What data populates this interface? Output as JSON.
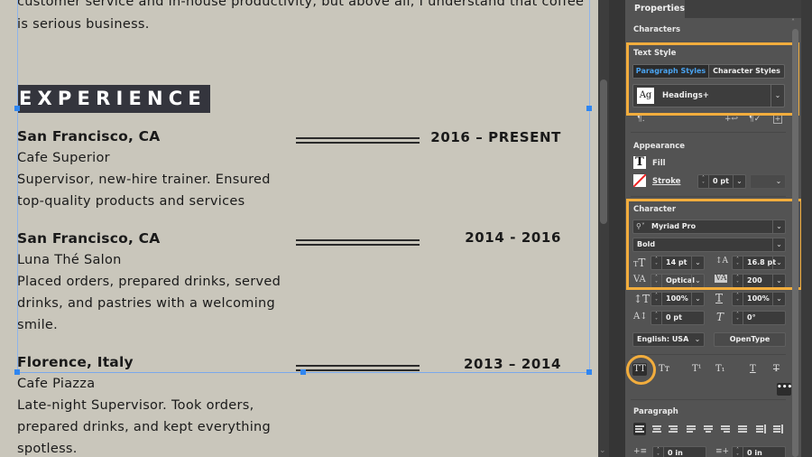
{
  "document": {
    "intro_lines": [
      "customer service and in-house productivity, but above all, I understand that coffee",
      "is serious business."
    ],
    "section_heading": "EXPERIENCE",
    "jobs": [
      {
        "location": "San Francisco, CA",
        "dates": "2016 – PRESENT",
        "employer": "Cafe Superior",
        "description_lines": [
          "Supervisor, new-hire trainer. Ensured",
          "top-quality products and services"
        ]
      },
      {
        "location": "San Francisco, CA",
        "dates": "2014 - 2016",
        "employer": "Luna Thé Salon",
        "description_lines": [
          "Placed orders, prepared drinks, served",
          "drinks, and pastries with a welcoming",
          "smile."
        ]
      },
      {
        "location": "Florence, Italy",
        "dates": "2013 – 2014",
        "employer": "Cafe Piazza",
        "description_lines": [
          "Late-night Supervisor. Took orders,",
          "prepared drinks, and kept everything",
          "spotless."
        ]
      }
    ]
  },
  "panel": {
    "tab": "Properties",
    "context": "Characters",
    "text_style": {
      "title": "Text Style",
      "tabs": [
        {
          "label": "Paragraph Styles",
          "active": true
        },
        {
          "label": "Character Styles",
          "active": false
        }
      ],
      "style_preview": "Ag",
      "selected_style": "Headings+",
      "actions": [
        "clear-overrides-icon",
        "new-style-from-selection-icon",
        "redefine-style-icon",
        "new-style-icon"
      ]
    },
    "appearance": {
      "title": "Appearance",
      "fill_label": "Fill",
      "stroke_label": "Stroke",
      "stroke_weight": "0 pt"
    },
    "character": {
      "title": "Character",
      "font_family": "Myriad Pro",
      "font_style": "Bold",
      "font_size": "14 pt",
      "leading": "16.8 pt",
      "kerning": "Optical",
      "tracking": "200",
      "vertical_scale": "100%",
      "horizontal_scale": "100%",
      "baseline_shift": "0 pt",
      "skew": "0°",
      "language": "English: USA",
      "opentype_label": "OpenType",
      "case_buttons": [
        {
          "label": "TT",
          "name": "all-caps",
          "active": true
        },
        {
          "label": "Tт",
          "name": "small-caps",
          "active": false
        },
        {
          "label": "T¹",
          "name": "superscript",
          "active": false
        },
        {
          "label": "T₁",
          "name": "subscript",
          "active": false
        },
        {
          "label": "T",
          "name": "underline",
          "active": false
        },
        {
          "label": "T",
          "name": "strikethrough",
          "active": false
        }
      ],
      "more_label": "•••"
    },
    "paragraph": {
      "title": "Paragraph",
      "left_indent": "0 in",
      "right_indent": "0 in"
    }
  },
  "colors": {
    "highlight": "#f2ad3d",
    "active_tab_text": "#4aa3f0",
    "heading_bg": "#34353d",
    "page_bg": "#c9c6bb",
    "panel_bg": "#535353"
  }
}
